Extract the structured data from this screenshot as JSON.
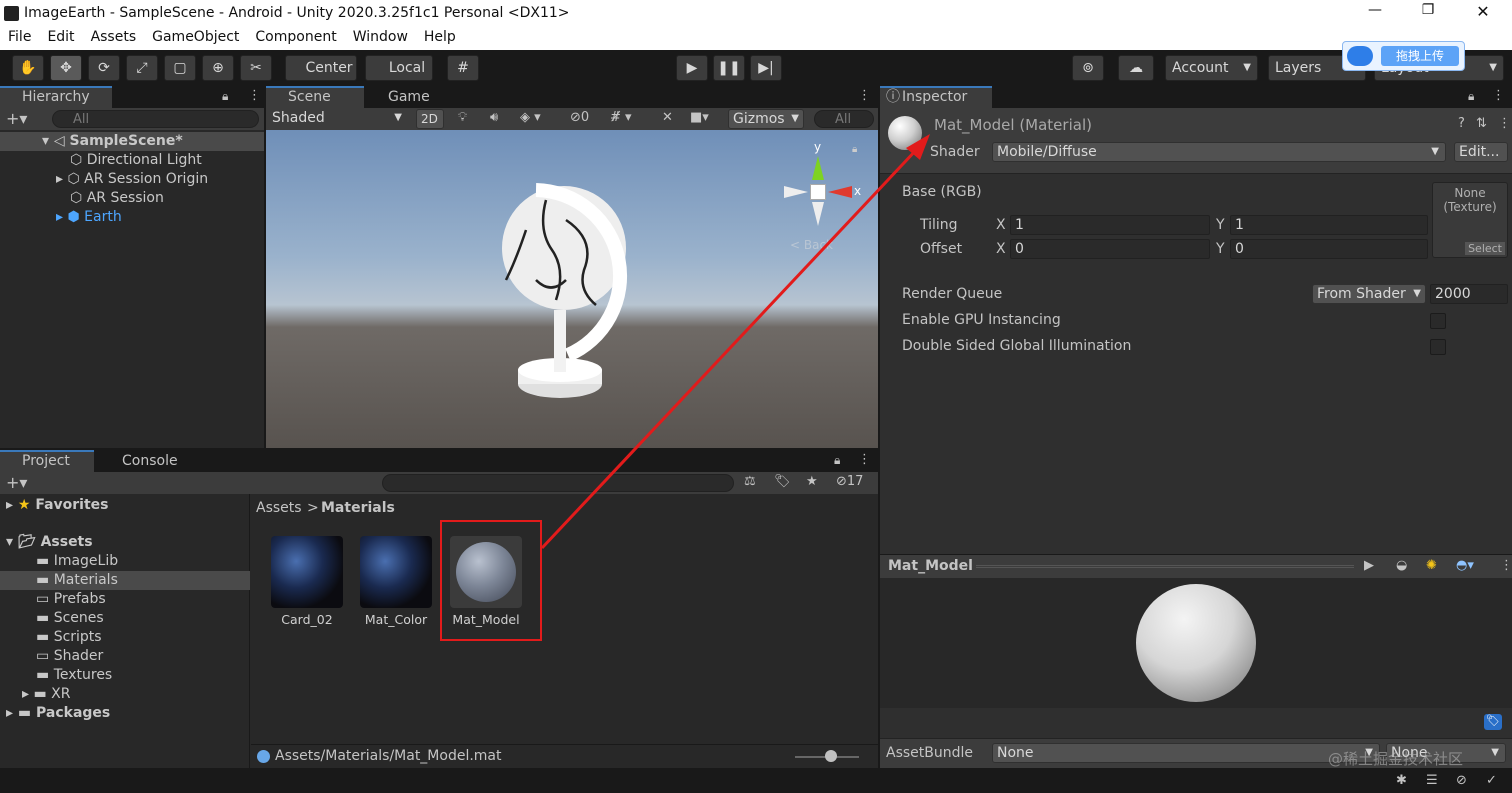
{
  "window": {
    "title": "ImageEarth - SampleScene - Android - Unity 2020.3.25f1c1 Personal <DX11>",
    "controls": [
      "—",
      "❐",
      "✕"
    ]
  },
  "menu": [
    "File",
    "Edit",
    "Assets",
    "GameObject",
    "Component",
    "Window",
    "Help"
  ],
  "toolbar": {
    "pivot": "Center",
    "space": "Local",
    "account": "Account",
    "layers": "Layers",
    "layout": "Layout",
    "overlay_badge": "拖拽上传"
  },
  "hierarchy": {
    "tab": "Hierarchy",
    "search_placeholder": "All",
    "scene": "SampleScene*",
    "items": [
      "Directional Light",
      "AR Session Origin",
      "AR Session",
      "Earth"
    ]
  },
  "scene_view": {
    "tab_scene": "Scene",
    "tab_game": "Game",
    "shading": "Shaded",
    "mode_2d": "2D",
    "hidden_count": "0",
    "gizmos": "Gizmos",
    "search_placeholder": "All",
    "axis_y": "y",
    "axis_x": "x",
    "view_label": "< Back"
  },
  "inspector": {
    "tab": "Inspector",
    "material_name": "Mat_Model (Material)",
    "shader_label": "Shader",
    "shader_value": "Mobile/Diffuse",
    "edit_button": "Edit...",
    "base_label": "Base (RGB)",
    "tiling_label": "Tiling",
    "offset_label": "Offset",
    "x_label": "X",
    "y_label": "Y",
    "tiling_x": "1",
    "tiling_y": "1",
    "offset_x": "0",
    "offset_y": "0",
    "texture_none": "None",
    "texture_kind": "(Texture)",
    "texture_select": "Select",
    "render_queue_label": "Render Queue",
    "render_queue_mode": "From Shader",
    "render_queue_value": "2000",
    "gpu_instancing_label": "Enable GPU Instancing",
    "double_sided_label": "Double Sided Global Illumination",
    "preview_title": "Mat_Model",
    "assetbundle_label": "AssetBundle",
    "assetbundle_value": "None",
    "assetbundle_variant": "None"
  },
  "project": {
    "tab_project": "Project",
    "tab_console": "Console",
    "hidden_count": "17",
    "favorites": "Favorites",
    "assets": "Assets",
    "folders": [
      "ImageLib",
      "Materials",
      "Prefabs",
      "Scenes",
      "Scripts",
      "Shader",
      "Textures",
      "XR"
    ],
    "packages": "Packages",
    "breadcrumb_root": "Assets",
    "breadcrumb_current": "Materials",
    "items": [
      "Card_02",
      "Mat_Color",
      "Mat_Model"
    ],
    "status_path": "Assets/Materials/Mat_Model.mat"
  },
  "watermark": "@稀土掘金技术社区",
  "colors": {
    "selection_accent": "#3a79bb",
    "annotation": "#e21b1b",
    "earth_label": "#4da6ff"
  }
}
